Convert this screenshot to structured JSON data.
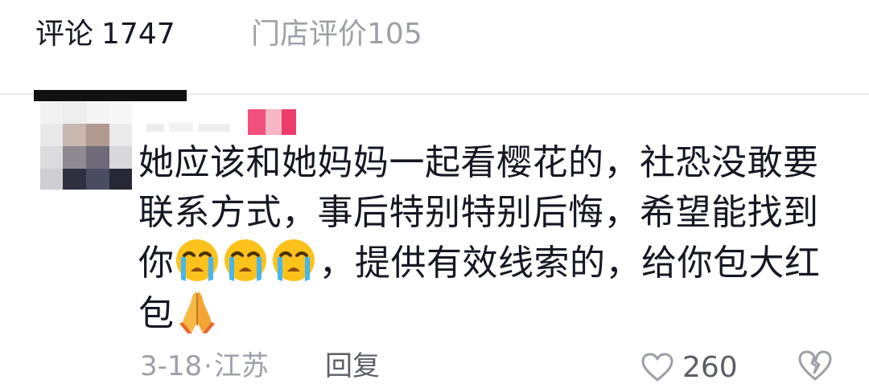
{
  "tabs": {
    "comments": {
      "label": "评论",
      "count": "1747"
    },
    "store_reviews": {
      "label": "门店评价",
      "count": "105"
    }
  },
  "comment": {
    "parts": [
      "她应该和她妈妈一起看樱花的，社恐没敢要联系方式，事后特别特别后悔，希望能找到你",
      "，提供有效线索的，给你包大红包"
    ],
    "emojis": [
      "crying-face-icon",
      "crying-face-icon",
      "crying-face-icon",
      "folded-hands-icon"
    ],
    "date": "3-18",
    "dot": "·",
    "location": "江苏",
    "reply_label": "回复",
    "like_count": "260"
  },
  "colors": {
    "primary_text": "#161823",
    "secondary_text": "#9ea0a8",
    "reply_text": "#5c5e66",
    "divider": "#ececee"
  }
}
